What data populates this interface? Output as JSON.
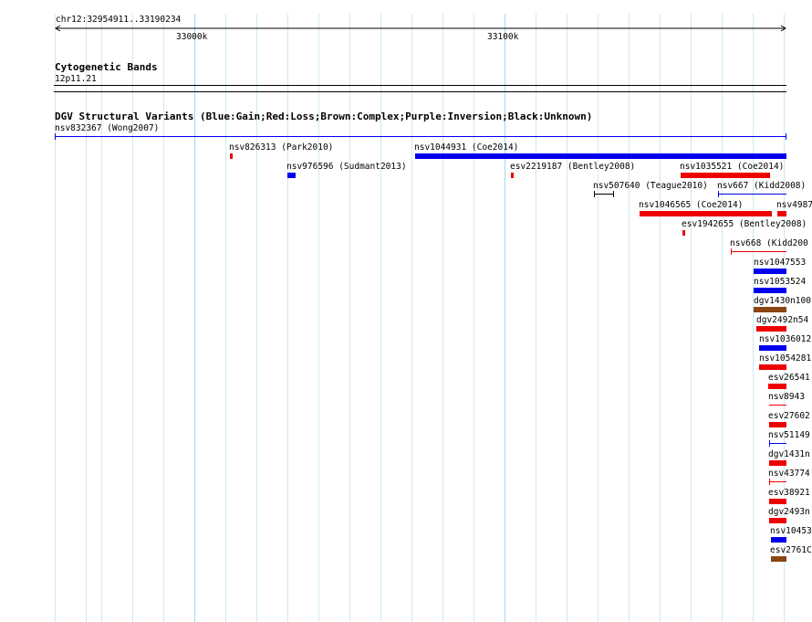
{
  "region": "chr12:32954911..33190234",
  "ruler": {
    "ticks": [
      "33000k",
      "33100k"
    ]
  },
  "cyto": {
    "title": "Cytogenetic Bands",
    "band": "12p11.21"
  },
  "dgv": {
    "title": "DGV Structural Variants (Blue:Gain;Red:Loss;Brown:Complex;Purple:Inversion;Black:Unknown)"
  },
  "colors": {
    "gain": "#0000ee",
    "loss": "#ee0000",
    "complex": "#8b4513",
    "unknown": "#000000"
  },
  "features": [
    {
      "name": "nsv832367 (Wong2007)",
      "type": "gain",
      "style": "thin"
    },
    {
      "name": "nsv826313 (Park2010)",
      "type": "loss",
      "style": "bar"
    },
    {
      "name": "nsv1044931 (Coe2014)",
      "type": "gain",
      "style": "bar"
    },
    {
      "name": "nsv976596 (Sudmant2013)",
      "type": "gain",
      "style": "bar"
    },
    {
      "name": "esv2219187 (Bentley2008)",
      "type": "loss",
      "style": "bar"
    },
    {
      "name": "nsv1035521 (Coe2014)",
      "type": "loss",
      "style": "bar"
    },
    {
      "name": "nsv507640 (Teague2010)",
      "type": "unknown",
      "style": "thin"
    },
    {
      "name": "nsv667 (Kidd2008)",
      "type": "gain",
      "style": "thin"
    },
    {
      "name": "nsv1046565 (Coe2014)",
      "type": "loss",
      "style": "bar"
    },
    {
      "name": "nsv4987",
      "type": "loss",
      "style": "bar"
    },
    {
      "name": "esv1942655 (Bentley2008)",
      "type": "loss",
      "style": "bar"
    },
    {
      "name": "nsv668 (Kidd200",
      "type": "loss",
      "style": "thin"
    },
    {
      "name": "nsv1047553",
      "type": "gain",
      "style": "bar"
    },
    {
      "name": "nsv1053524",
      "type": "gain",
      "style": "bar"
    },
    {
      "name": "dgv1430n100",
      "type": "complex",
      "style": "bar"
    },
    {
      "name": "dgv2492n54",
      "type": "loss",
      "style": "bar"
    },
    {
      "name": "nsv1036012",
      "type": "gain",
      "style": "bar"
    },
    {
      "name": "nsv1054281",
      "type": "loss",
      "style": "bar"
    },
    {
      "name": "esv26541",
      "type": "loss",
      "style": "bar"
    },
    {
      "name": "nsv8943",
      "type": "loss",
      "style": "thin"
    },
    {
      "name": "esv27602",
      "type": "loss",
      "style": "bar"
    },
    {
      "name": "nsv51149",
      "type": "gain",
      "style": "thin"
    },
    {
      "name": "dgv1431n",
      "type": "loss",
      "style": "bar"
    },
    {
      "name": "nsv43774",
      "type": "loss",
      "style": "thin"
    },
    {
      "name": "esv38921",
      "type": "loss",
      "style": "bar"
    },
    {
      "name": "dgv2493n",
      "type": "loss",
      "style": "bar"
    },
    {
      "name": "nsv10453",
      "type": "gain",
      "style": "bar"
    },
    {
      "name": "esv2761C",
      "type": "complex",
      "style": "bar"
    }
  ]
}
